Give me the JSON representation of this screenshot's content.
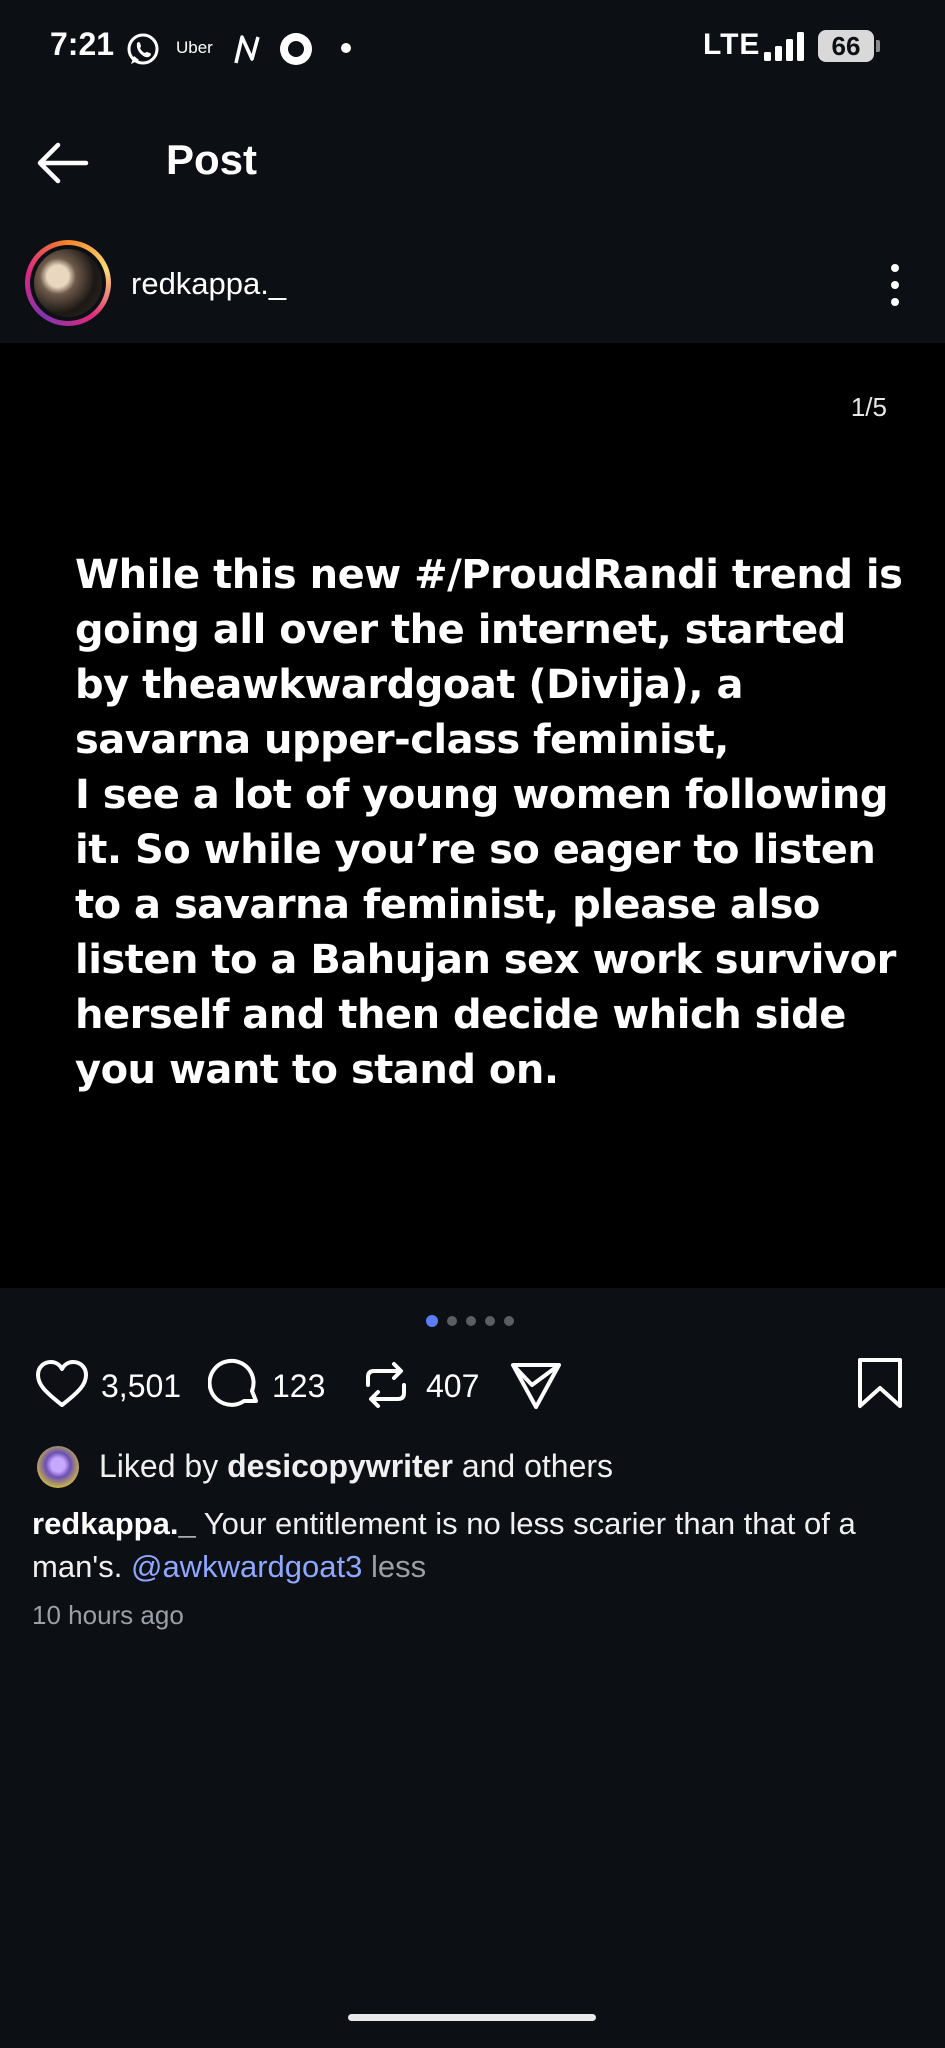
{
  "status_bar": {
    "time": "7:21",
    "uber_label": "Uber",
    "network": "LTE",
    "battery": "66"
  },
  "header": {
    "title": "Post"
  },
  "author": {
    "username": "redkappa._"
  },
  "post": {
    "page_indicator": "1/5",
    "text": "While this new #/ProudRandi trend is\ngoing all over the internet, started\nby theawkwardgoat (Divija), a\nsavarna upper-class feminist,\nI see a lot of young women following\nit. So while you’re so eager to listen\nto a savarna feminist, please also\nlisten to a Bahujan sex work survivor\nherself and then decide which side\nyou want to stand on.",
    "carousel_total": 5,
    "carousel_active": 1
  },
  "actions": {
    "likes": "3,501",
    "comments": "123",
    "reposts": "407"
  },
  "likes_line": {
    "prefix": "Liked by",
    "user": "desicopywriter",
    "suffix": "and others"
  },
  "caption": {
    "username": "redkappa._",
    "text": "Your entitlement is no less scarier than that of a man's.",
    "mention": "@awkwardgoat3",
    "less_label": "less"
  },
  "timestamp": "10 hours ago",
  "colors": {
    "background": "#0c0f14",
    "media_background": "#000000",
    "accent_dot": "#5b7cf7",
    "mention": "#8ea8ff",
    "muted": "#9aa0a6"
  },
  "icons": [
    "whatsapp-icon",
    "n-app-icon",
    "circle-app-icon",
    "signal-icon",
    "back-arrow-icon",
    "more-vertical-icon",
    "heart-icon",
    "comment-icon",
    "repost-icon",
    "share-icon",
    "bookmark-icon"
  ]
}
